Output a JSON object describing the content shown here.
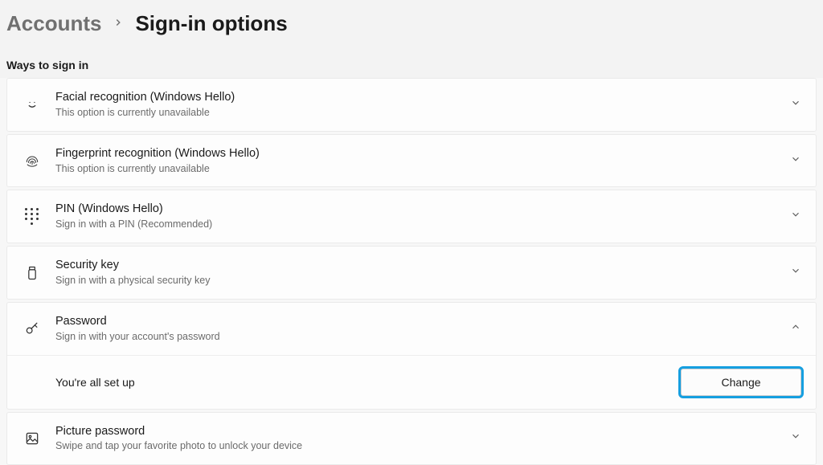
{
  "breadcrumb": {
    "parent": "Accounts",
    "current": "Sign-in options"
  },
  "section_heading": "Ways to sign in",
  "options": {
    "facial": {
      "title": "Facial recognition (Windows Hello)",
      "desc": "This option is currently unavailable"
    },
    "fingerprint": {
      "title": "Fingerprint recognition (Windows Hello)",
      "desc": "This option is currently unavailable"
    },
    "pin": {
      "title": "PIN (Windows Hello)",
      "desc": "Sign in with a PIN (Recommended)"
    },
    "security_key": {
      "title": "Security key",
      "desc": "Sign in with a physical security key"
    },
    "password": {
      "title": "Password",
      "desc": "Sign in with your account's password",
      "expanded_status": "You're all set up",
      "change_label": "Change"
    },
    "picture": {
      "title": "Picture password",
      "desc": "Swipe and tap your favorite photo to unlock your device"
    }
  }
}
